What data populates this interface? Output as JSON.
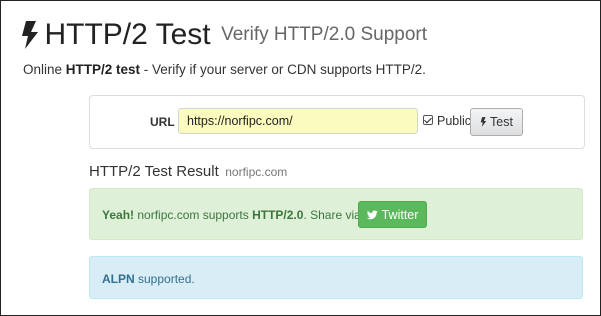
{
  "header": {
    "title": "HTTP/2 Test",
    "subtitle": "Verify HTTP/2.0 Support",
    "tagline_prefix": "Online ",
    "tagline_bold": "HTTP/2 test",
    "tagline_rest": " - Verify if your server or CDN supports HTTP/2."
  },
  "form": {
    "url_label": "URL",
    "url_value": "https://norfipc.com/",
    "public_label": "Public",
    "public_checked": true,
    "test_button_label": "Test"
  },
  "result": {
    "heading": "HTTP/2 Test Result",
    "host": "norfipc.com",
    "success": {
      "lead": "Yeah!",
      "host": " norfipc.com supports ",
      "protocol": "HTTP/2.0",
      "share": ". Share via:",
      "twitter_label": "Twitter"
    },
    "info": {
      "lead": "ALPN",
      "rest": " supported."
    }
  },
  "colors": {
    "success_bg": "#dff0d8",
    "success_text": "#3c763d",
    "twitter_button": "#5cb85c",
    "info_bg": "#d9edf7",
    "info_text": "#31708f",
    "url_input_bg": "#fbfbbf"
  },
  "icons": {
    "title_icon": "bolt-icon",
    "test_button_icon": "bolt-icon",
    "twitter_icon": "twitter-bird-icon"
  }
}
